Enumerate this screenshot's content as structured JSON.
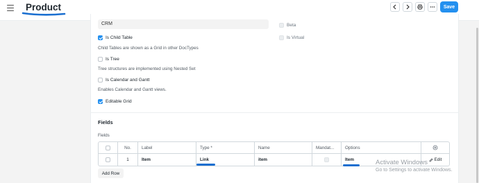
{
  "header": {
    "title": "Product",
    "save_label": "Save",
    "prev_icon": "chevron-left-icon",
    "next_icon": "chevron-right-icon",
    "print_icon": "printer-icon",
    "more_icon": "more-horizontal-icon"
  },
  "form": {
    "module_value": "CRM",
    "is_child_table": {
      "label": "Is Child Table",
      "checked": true,
      "description": "Child Tables are shown as a Grid in other DocTypes"
    },
    "is_tree": {
      "label": "Is Tree",
      "checked": false,
      "description": "Tree structures are implemented using Nested Set"
    },
    "is_calendar": {
      "label": "Is Calendar and Gantt",
      "checked": false,
      "description": "Enables Calendar and Gantt views."
    },
    "editable_grid": {
      "label": "Editable Grid",
      "checked": true
    },
    "beta": {
      "label": "Beta",
      "checked": false
    },
    "is_virtual": {
      "label": "Is Virtual",
      "checked": false
    }
  },
  "fields_section": {
    "title": "Fields",
    "label": "Fields",
    "columns": [
      "No.",
      "Label",
      "Type *",
      "Name",
      "Mandat...",
      "Options"
    ],
    "rows": [
      {
        "no": "1",
        "label": "Item",
        "type": "Link",
        "name": "item",
        "mandatory": false,
        "options": "Item",
        "edit_label": "Edit"
      }
    ],
    "add_row_label": "Add Row",
    "settings_icon": "settings-icon"
  },
  "watermark": {
    "title": "Activate Windows",
    "subtitle": "Go to Settings to activate Windows."
  },
  "colors": {
    "primary": "#2490ef",
    "annotation": "#1a6fd0"
  }
}
